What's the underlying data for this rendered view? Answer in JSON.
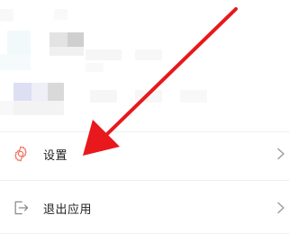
{
  "menu": {
    "items": [
      {
        "label": "设置",
        "icon": "gear-icon",
        "icon_color": "#f07060"
      },
      {
        "label": "退出应用",
        "icon": "exit-icon",
        "icon_color": "#8a8a8a"
      }
    ]
  },
  "colors": {
    "annotation_arrow": "#e8181c",
    "divider": "#efefef",
    "chevron": "#9a9a9a"
  }
}
